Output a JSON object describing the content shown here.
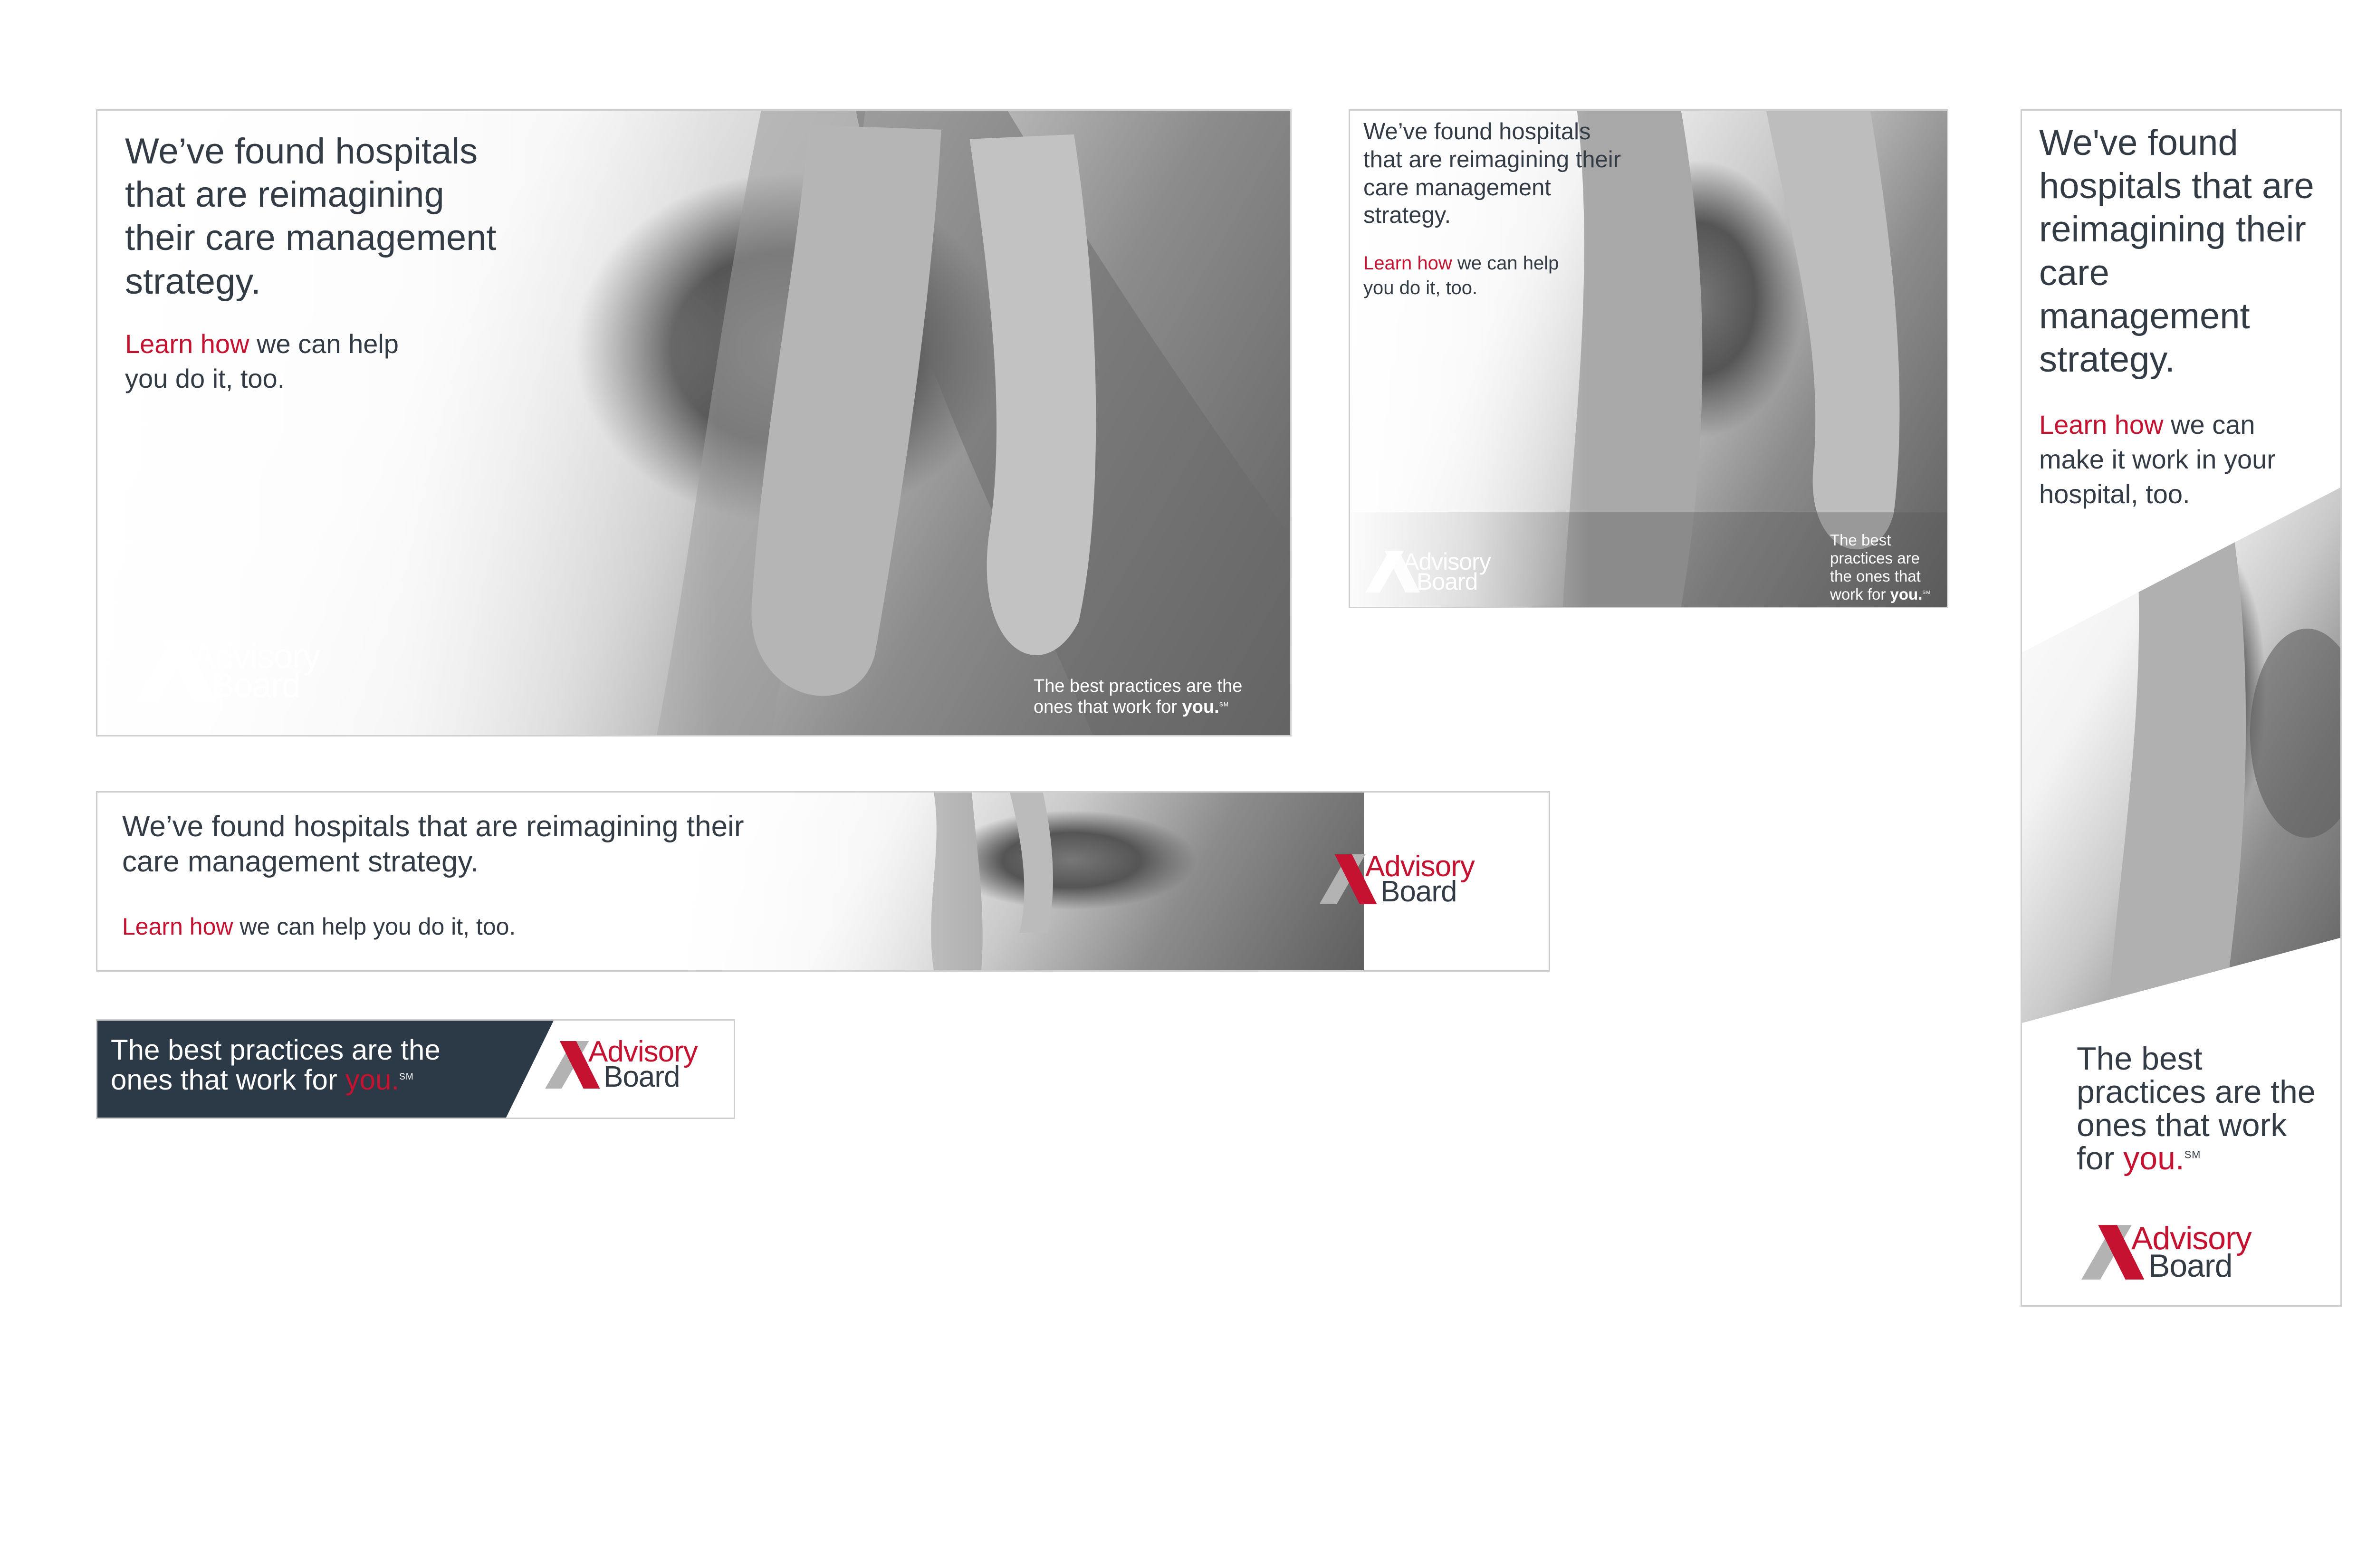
{
  "brand": {
    "name_line1": "Advisory",
    "name_line2": "Board",
    "colors": {
      "red": "#c41230",
      "gray_mark": "#b3b3b3",
      "navy": "#2c3a47",
      "text": "#333b44"
    }
  },
  "ad_large": {
    "headline": "We’ve found hospitals that are reimagining their care management strategy.",
    "cta_link": "Learn how",
    "cta_rest": " we can help you do it, too.",
    "tagline_pre": "The best practices are the ones that work for ",
    "tagline_you": "you.",
    "tagline_sm": "SM"
  },
  "ad_medium": {
    "headline": "We’ve found hospitals that are reimagining their care management strategy.",
    "cta_link": "Learn how",
    "cta_rest": " we can help you do it, too.",
    "tagline_pre": "The best practices are the ones that work for ",
    "tagline_you": "you.",
    "tagline_sm": "SM"
  },
  "ad_leaderboard": {
    "headline": "We’ve found hospitals that are reimagining their care management strategy.",
    "cta_link": "Learn how",
    "cta_rest": " we can help you do it, too."
  },
  "ad_small_banner": {
    "tagline_pre": "The best practices are the ones that work for ",
    "tagline_you": "you.",
    "tagline_sm": "SM"
  },
  "ad_skyscraper": {
    "headline": "We've found hospitals that are reimagining their care management strategy.",
    "cta_link": "Learn how",
    "cta_rest": " we can make it work in your hospital, too.",
    "tagline_pre": "The best practices are the ones that work for ",
    "tagline_you": "you.",
    "tagline_sm": "SM"
  }
}
